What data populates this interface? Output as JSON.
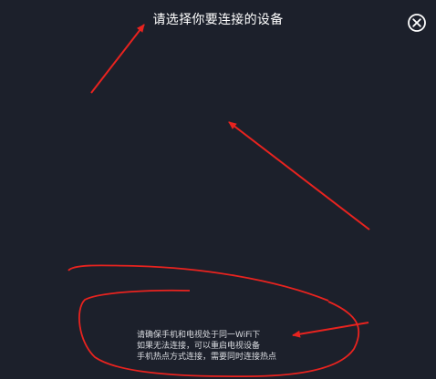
{
  "dialog": {
    "title": "请选择你要连接的设备"
  },
  "close_icon": "close-circle-icon",
  "hint": {
    "line1": "请确保手机和电视处于同一WiFi下",
    "line2": "如果无法连接，可以重启电视设备",
    "line3": "手机热点方式连接，需要同时连接热点"
  },
  "colors": {
    "background": "#1c202b",
    "annotation": "#e8231f"
  }
}
